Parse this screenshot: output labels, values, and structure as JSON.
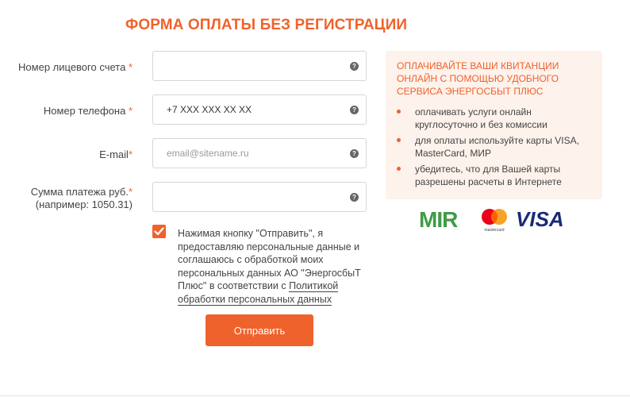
{
  "form": {
    "title": "ФОРМА ОПЛАТЫ БЕЗ РЕГИСТРАЦИИ",
    "required_mark": "*",
    "fields": [
      {
        "label": "Номер лицевого счета",
        "placeholder": "",
        "value": ""
      },
      {
        "label": "Номер телефона",
        "placeholder": "+7 XXX XXX XX XX",
        "value": ""
      },
      {
        "label": "E-mail",
        "placeholder": "email@sitename.ru",
        "value": ""
      },
      {
        "label_line1": "Сумма платежа руб.",
        "label_line2": "(например: 1050.31)",
        "placeholder": "",
        "value": ""
      }
    ],
    "help_glyph": "?",
    "consent": {
      "checked": true,
      "text": "Нажимая кнопку \"Отправить\", я предоставляю персональные данные и соглашаюсь с обработкой моих персональных данных АО \"ЭнергосбыТ Плюс\" в соответствии с ",
      "link_text": "Политикой обработки персональных данных"
    },
    "submit_label": "Отправить"
  },
  "info": {
    "title": "ОПЛАЧИВАЙТЕ ВАШИ КВИТАНЦИИ ОНЛАЙН С ПОМОЩЬЮ УДОБНОГО СЕРВИСА ЭНЕРГОСБЫТ ПЛЮС",
    "items": [
      "оплачивать услуги онлайн круглосуточно и без комиссии",
      "для оплаты используйте карты VISA, MasterCard, МИР",
      "убедитесь, что для Вашей карты разрешены расчеты в Интернете"
    ]
  },
  "payment_logos": {
    "mir": "MIR",
    "mastercard": "mastercard",
    "visa": "VISA"
  },
  "colors": {
    "accent": "#f0622b",
    "info_bg": "#fdf2ec",
    "mir_green": "#3f9b46",
    "visa_blue": "#1a2b75",
    "mc_red": "#eb001b",
    "mc_yellow": "#f79e1b"
  },
  "icons": [
    "help-icon",
    "checkmark-icon",
    "bullet-icon"
  ]
}
